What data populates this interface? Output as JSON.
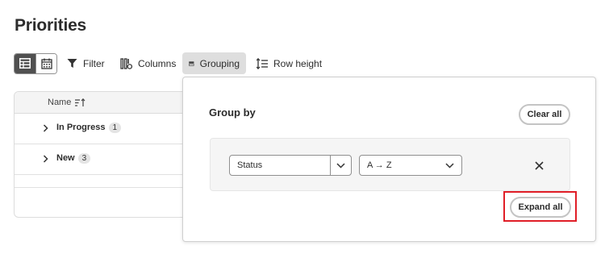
{
  "page": {
    "title": "Priorities"
  },
  "toolbar": {
    "view_table_icon": "table-view-icon",
    "view_calendar_icon": "calendar-view-icon",
    "filter_label": "Filter",
    "columns_label": "Columns",
    "grouping_label": "Grouping",
    "row_height_label": "Row height"
  },
  "grid": {
    "column_name": "Name",
    "groups": [
      {
        "label": "In Progress",
        "count": "1"
      },
      {
        "label": "New",
        "count": "3"
      }
    ]
  },
  "group_by_panel": {
    "title": "Group by",
    "clear_all_label": "Clear all",
    "field_value": "Status",
    "sort_value": "A → Z",
    "expand_all_label": "Expand all"
  },
  "colors": {
    "highlight": "#e01e27",
    "active_view": "#505050"
  }
}
